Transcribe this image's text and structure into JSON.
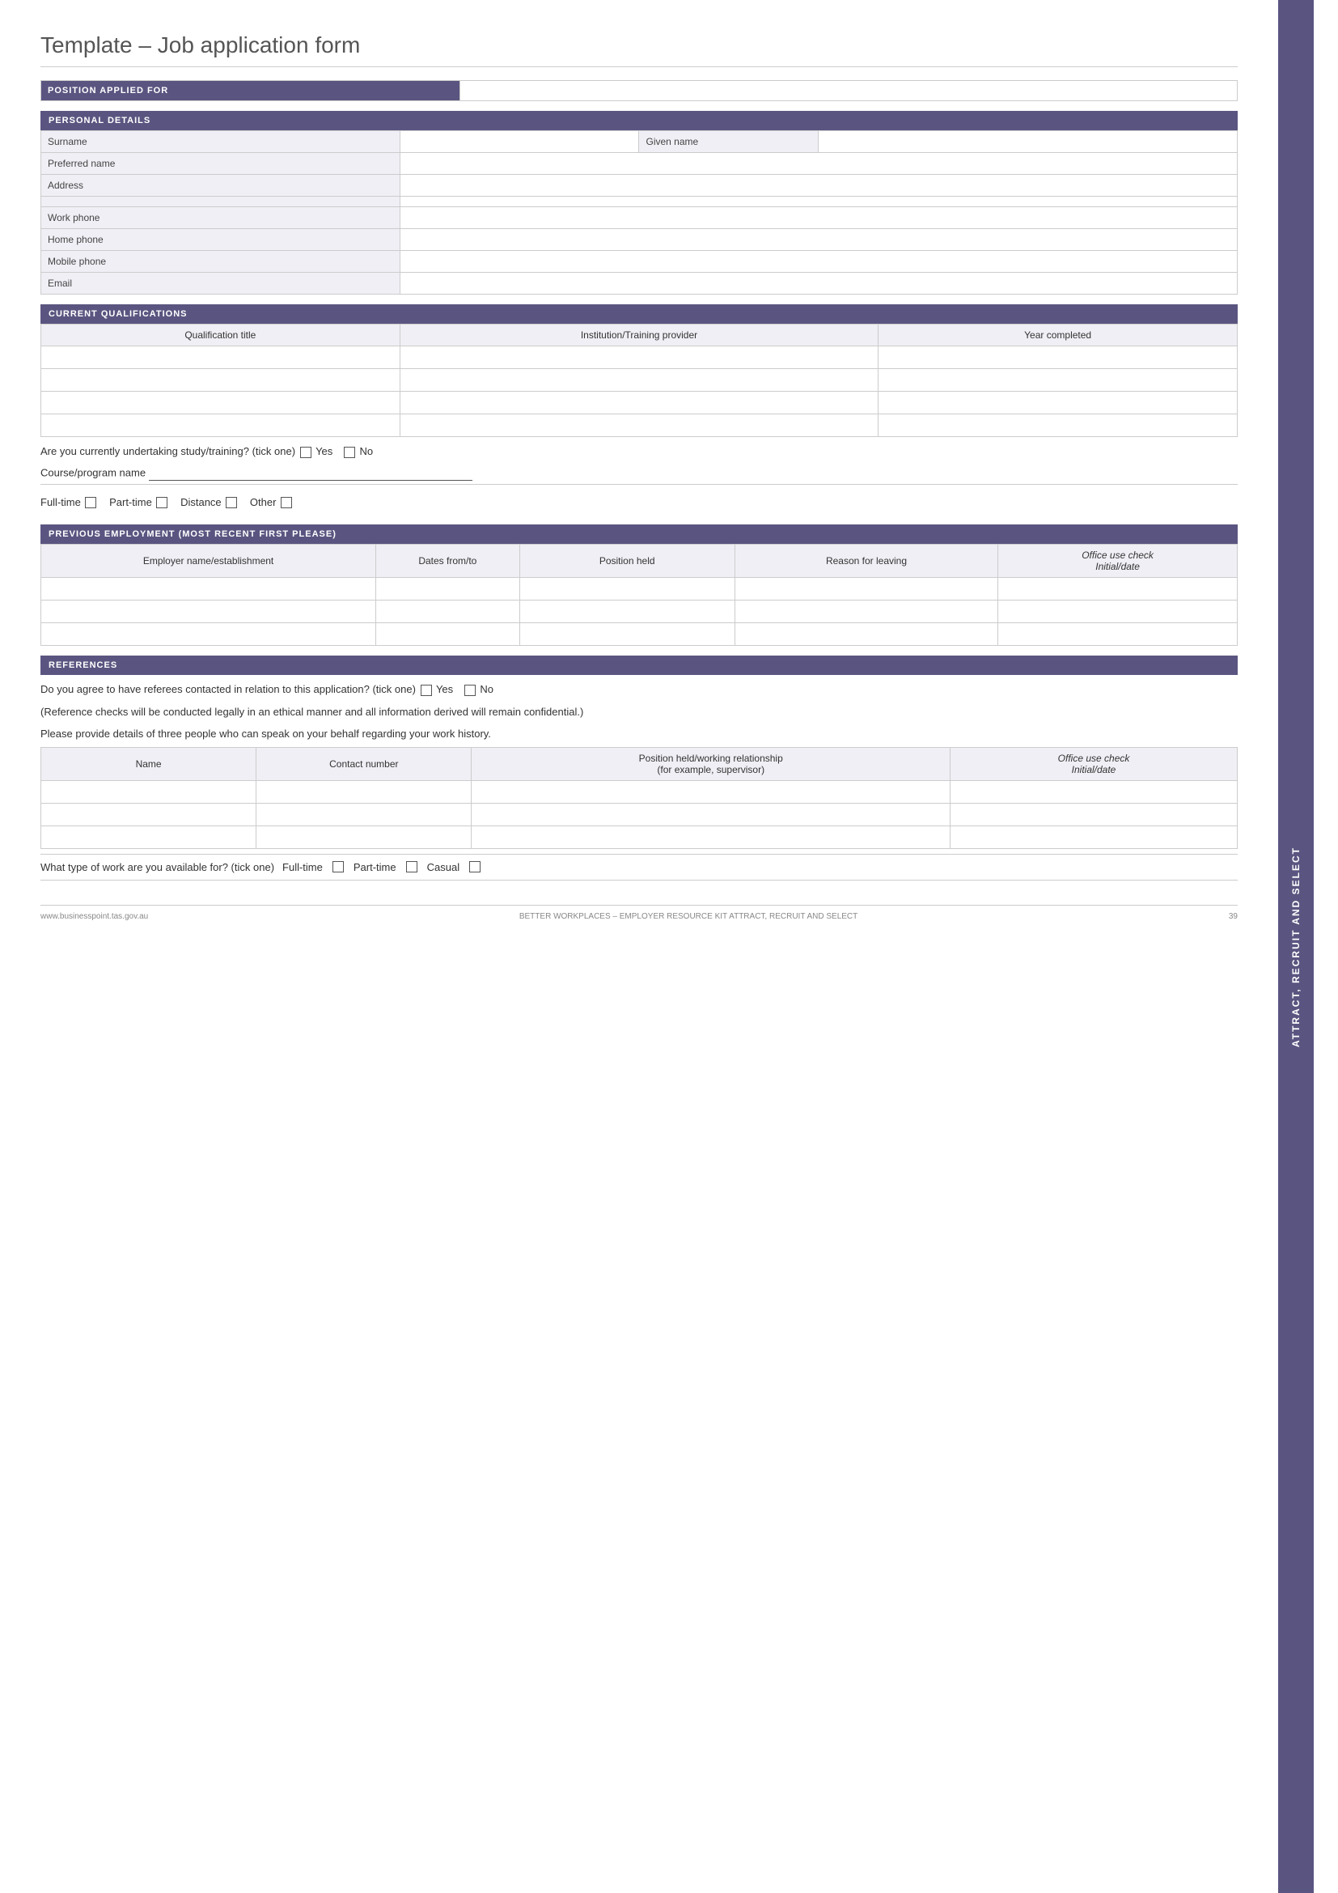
{
  "page": {
    "title": "Template – Job application form",
    "side_tab": "Attract, Recruit and Select"
  },
  "sections": {
    "position": {
      "label": "POSITION APPLIED FOR"
    },
    "personal": {
      "label": "PERSONAL DETAILS",
      "fields": [
        {
          "label": "Surname",
          "second_label": "Given name"
        },
        {
          "label": "Preferred name"
        },
        {
          "label": "Address"
        },
        {
          "label": ""
        },
        {
          "label": "Work phone"
        },
        {
          "label": "Home phone"
        },
        {
          "label": "Mobile phone"
        },
        {
          "label": "Email"
        }
      ]
    },
    "qualifications": {
      "label": "CURRENT QUALIFICATIONS",
      "col1": "Qualification title",
      "col2": "Institution/Training provider",
      "col3": "Year completed",
      "study_question": "Are you currently undertaking study/training? (tick one)",
      "yes_label": "Yes",
      "no_label": "No",
      "course_label": "Course/program name",
      "fulltime_label": "Full-time",
      "parttime_label": "Part-time",
      "distance_label": "Distance",
      "other_label": "Other"
    },
    "employment": {
      "label": "PREVIOUS EMPLOYMENT (MOST RECENT FIRST PLEASE)",
      "col1": "Employer name/establishment",
      "col2": "Dates from/to",
      "col3": "Position held",
      "col4": "Reason for leaving",
      "col5_line1": "Office use check",
      "col5_line2": "Initial/date"
    },
    "references": {
      "label": "REFERENCES",
      "question": "Do you agree to have referees contacted in relation to this application? (tick one)",
      "yes_label": "Yes",
      "no_label": "No",
      "para1": "(Reference checks will be conducted legally in an ethical manner and all information derived will remain confidential.)",
      "para2": "Please provide details of three people who can speak on your behalf regarding your work history.",
      "col1": "Name",
      "col2": "Contact number",
      "col3_line1": "Position held/working relationship",
      "col3_line2": "(for example, supervisor)",
      "col4_line1": "Office use check",
      "col4_line2": "Initial/date",
      "work_type_question": "What type of work are you available for? (tick one)",
      "fulltime_label": "Full-time",
      "parttime_label": "Part-time",
      "casual_label": "Casual"
    }
  },
  "footer": {
    "left": "www.businesspoint.tas.gov.au",
    "center": "BETTER WORKPLACES – EMPLOYER RESOURCE KIT ATTRACT, RECRUIT AND SELECT",
    "right": "39"
  }
}
